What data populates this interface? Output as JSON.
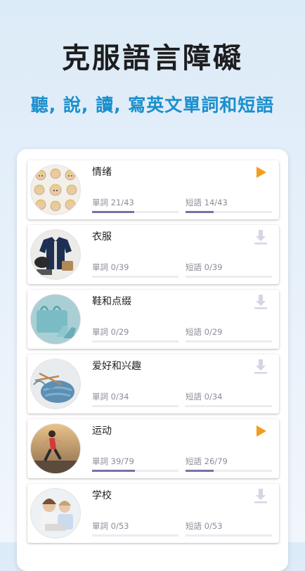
{
  "hero": {
    "title": "克服語言障礙",
    "subtitle": "聽, 說, 讀, 寫英文單詞和短語"
  },
  "colors": {
    "accent_blue": "#1a8fcc",
    "progress": "#7d6ea6",
    "play": "#f39c1e",
    "download": "#d7d4e4"
  },
  "topics": [
    {
      "name": "情绪",
      "thumb_icon": "faces-collage-icon",
      "action_icon": "play-icon",
      "words_label": "單詞 21/43",
      "phrases_label": "短語 14/43",
      "words_progress": 0.488,
      "phrases_progress": 0.326
    },
    {
      "name": "衣服",
      "thumb_icon": "clothes-icon",
      "action_icon": "download-icon",
      "words_label": "單詞 0/39",
      "phrases_label": "短語 0/39",
      "words_progress": 0,
      "phrases_progress": 0
    },
    {
      "name": "鞋和点缀",
      "thumb_icon": "shoes-bag-icon",
      "action_icon": "download-icon",
      "words_label": "單詞 0/29",
      "phrases_label": "短語 0/29",
      "words_progress": 0,
      "phrases_progress": 0
    },
    {
      "name": "爱好和兴趣",
      "thumb_icon": "knitting-icon",
      "action_icon": "download-icon",
      "words_label": "單詞 0/34",
      "phrases_label": "短語 0/34",
      "words_progress": 0,
      "phrases_progress": 0
    },
    {
      "name": "运动",
      "thumb_icon": "runner-icon",
      "action_icon": "play-icon",
      "words_label": "單詞 39/79",
      "phrases_label": "短語 26/79",
      "words_progress": 0.494,
      "phrases_progress": 0.329
    },
    {
      "name": "学校",
      "thumb_icon": "students-icon",
      "action_icon": "download-icon",
      "words_label": "單詞 0/53",
      "phrases_label": "短語 0/53",
      "words_progress": 0,
      "phrases_progress": 0
    }
  ]
}
